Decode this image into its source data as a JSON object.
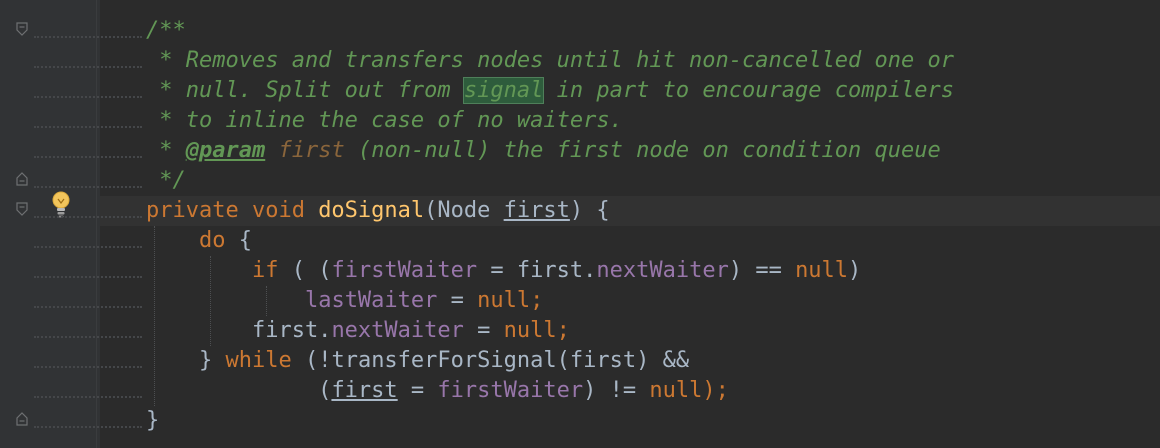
{
  "editor": {
    "lines": [
      {
        "id": "doc-open",
        "segments": [
          {
            "t": "/**",
            "c": "c-doc"
          }
        ]
      },
      {
        "id": "doc-1",
        "segments": [
          {
            "t": " * Removes and transfers nodes until hit non-cancelled one or",
            "c": "c-doc"
          }
        ]
      },
      {
        "id": "doc-2",
        "segments": [
          {
            "t": " * null. Split out from ",
            "c": "c-doc"
          },
          {
            "t": "signal",
            "c": "c-doc c-hl"
          },
          {
            "t": " in part to encourage compilers",
            "c": "c-doc"
          }
        ]
      },
      {
        "id": "doc-3",
        "segments": [
          {
            "t": " * to inline the case of no waiters.",
            "c": "c-doc"
          }
        ]
      },
      {
        "id": "doc-4",
        "segments": [
          {
            "t": " * ",
            "c": "c-doc"
          },
          {
            "t": "@param",
            "c": "c-tag"
          },
          {
            "t": " ",
            "c": "c-doc"
          },
          {
            "t": "first",
            "c": "c-param"
          },
          {
            "t": " (non-null) the first node on condition queue",
            "c": "c-doc"
          }
        ]
      },
      {
        "id": "doc-close",
        "segments": [
          {
            "t": " */",
            "c": "c-doc"
          }
        ]
      },
      {
        "id": "method-sig",
        "segments": [
          {
            "t": "private void ",
            "c": "kw"
          },
          {
            "t": "doSignal",
            "c": "fn"
          },
          {
            "t": "(Node ",
            "c": ""
          },
          {
            "t": "first",
            "c": "ul"
          },
          {
            "t": ") {",
            "c": ""
          }
        ]
      },
      {
        "id": "do-line",
        "segments": [
          {
            "t": "    ",
            "c": ""
          },
          {
            "t": "do",
            "c": "kw"
          },
          {
            "t": " {",
            "c": ""
          }
        ]
      },
      {
        "id": "if-line",
        "segments": [
          {
            "t": "        ",
            "c": ""
          },
          {
            "t": "if",
            "c": "kw"
          },
          {
            "t": " ( (",
            "c": ""
          },
          {
            "t": "firstWaiter",
            "c": "fld"
          },
          {
            "t": " = first.",
            "c": ""
          },
          {
            "t": "nextWaiter",
            "c": "fld"
          },
          {
            "t": ") == ",
            "c": ""
          },
          {
            "t": "null",
            "c": "kw"
          },
          {
            "t": ")",
            "c": ""
          }
        ]
      },
      {
        "id": "last-waiter-line",
        "segments": [
          {
            "t": "            ",
            "c": ""
          },
          {
            "t": "lastWaiter",
            "c": "fld"
          },
          {
            "t": " = ",
            "c": ""
          },
          {
            "t": "null",
            "c": "kw"
          },
          {
            "t": ";",
            "c": "kw"
          }
        ]
      },
      {
        "id": "next-waiter-line",
        "segments": [
          {
            "t": "        first.",
            "c": ""
          },
          {
            "t": "nextWaiter",
            "c": "fld"
          },
          {
            "t": " = ",
            "c": ""
          },
          {
            "t": "null",
            "c": "kw"
          },
          {
            "t": ";",
            "c": "kw"
          }
        ]
      },
      {
        "id": "while-line",
        "segments": [
          {
            "t": "    } ",
            "c": ""
          },
          {
            "t": "while",
            "c": "kw"
          },
          {
            "t": " (!transferForSignal(first) &&",
            "c": ""
          }
        ]
      },
      {
        "id": "while-cond-line",
        "segments": [
          {
            "t": "             (",
            "c": ""
          },
          {
            "t": "first",
            "c": "ul"
          },
          {
            "t": " = ",
            "c": ""
          },
          {
            "t": "firstWaiter",
            "c": "fld"
          },
          {
            "t": ") != ",
            "c": ""
          },
          {
            "t": "null",
            "c": "kw"
          },
          {
            "t": ");",
            "c": "kw"
          }
        ]
      },
      {
        "id": "close-brace",
        "segments": [
          {
            "t": "}",
            "c": ""
          }
        ]
      }
    ]
  },
  "gutter": {
    "intention_icon": "lightbulb-icon",
    "fold_icons": [
      "fold-open-icon",
      "fold-close-icon",
      "fold-open-icon",
      "fold-close-icon"
    ]
  },
  "colors": {
    "background": "#2b2b2b",
    "gutter": "#313335",
    "doc_comment": "#629755",
    "keyword": "#cc7832",
    "method": "#ffc66d",
    "field": "#9876aa",
    "text": "#a9b7c6"
  }
}
